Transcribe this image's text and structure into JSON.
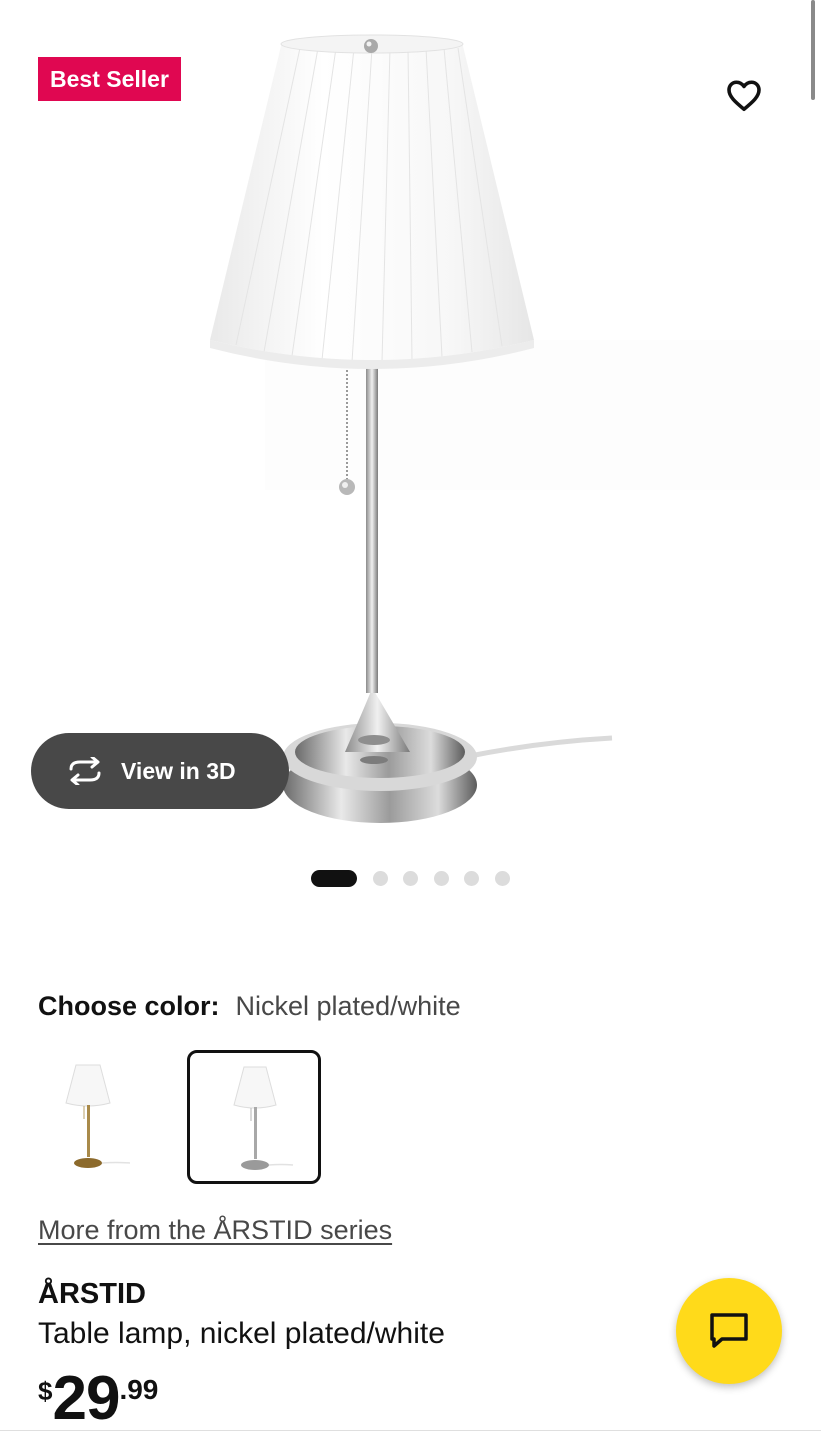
{
  "badge": {
    "label": "Best Seller",
    "color": "#e00751"
  },
  "favorite": {
    "icon": "heart-outline-icon"
  },
  "gallery": {
    "view_3d_label": "View in 3D",
    "view_3d_icon": "rotate-3d-icon",
    "image_count": 6,
    "active_index": 0
  },
  "color_picker": {
    "label": "Choose color:",
    "selected_value": "Nickel plated/white",
    "options": [
      {
        "name": "brass-white",
        "selected": false
      },
      {
        "name": "nickel-white",
        "selected": true
      }
    ]
  },
  "series_link": "More from the ÅRSTID series",
  "product": {
    "name": "ÅRSTID",
    "description": "Table lamp, nickel plated/white",
    "price": {
      "currency": "$",
      "integer": "29",
      "decimal": ".99"
    }
  },
  "chat": {
    "icon": "chat-bubble-icon",
    "color": "#ffda1a"
  }
}
